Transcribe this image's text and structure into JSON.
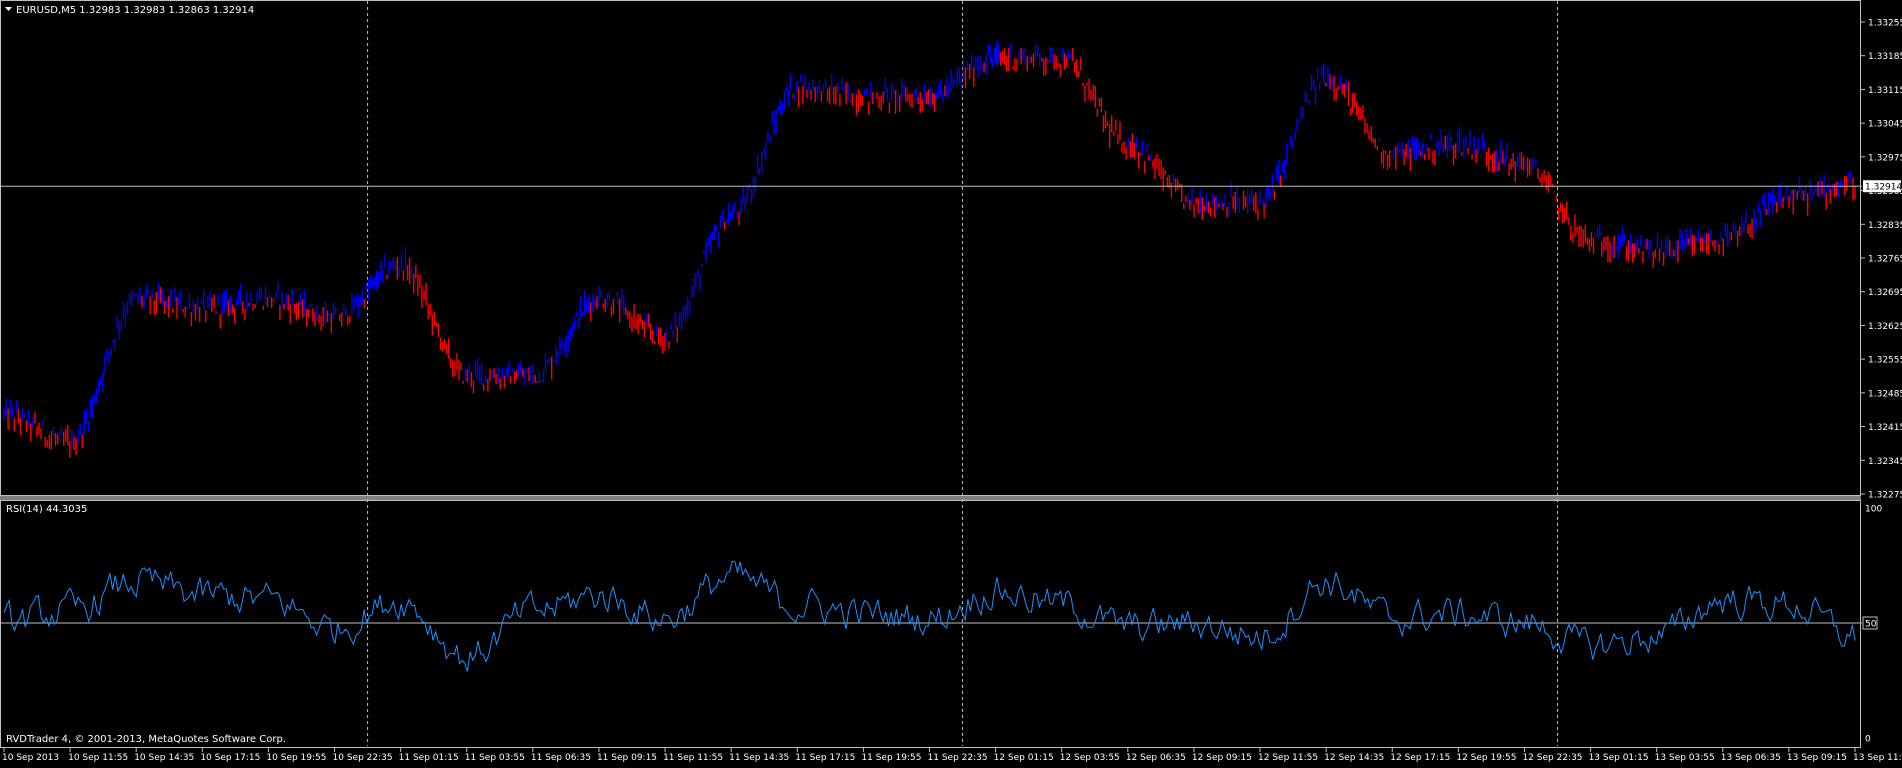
{
  "colors": {
    "background": "#000000",
    "frame": "#c0c0c0",
    "text": "#ffffff",
    "grid_dashed": "#c0c0c0",
    "bull": "#0000ff",
    "bear": "#ff0000",
    "rsi_line": "#1e90ff",
    "ref_line": "#c0c0c0"
  },
  "header": {
    "symbol_info": "EURUSD,M5  1.32983 1.32983 1.32863 1.32914",
    "dropdown_icon": "triangle-down-icon"
  },
  "price_panel": {
    "y_ticks": [
      "1.33255",
      "1.33185",
      "1.33115",
      "1.33045",
      "1.32975",
      "1.32905",
      "1.32835",
      "1.32765",
      "1.32695",
      "1.32625",
      "1.32555",
      "1.32485",
      "1.32415",
      "1.32345",
      "1.32275"
    ],
    "current_price": "1.32914"
  },
  "rsi_panel": {
    "label": "RSI(14) 44.3035",
    "y_ticks": [
      "100",
      "50",
      "0"
    ]
  },
  "x_ticks": [
    "10 Sep 2013",
    "10 Sep 11:55",
    "10 Sep 14:35",
    "10 Sep 17:15",
    "10 Sep 19:55",
    "10 Sep 22:35",
    "11 Sep 01:15",
    "11 Sep 03:55",
    "11 Sep 06:35",
    "11 Sep 09:15",
    "11 Sep 11:55",
    "11 Sep 14:35",
    "11 Sep 17:15",
    "11 Sep 19:55",
    "11 Sep 22:35",
    "12 Sep 01:15",
    "12 Sep 03:55",
    "12 Sep 06:35",
    "12 Sep 09:15",
    "12 Sep 11:55",
    "12 Sep 14:35",
    "12 Sep 17:15",
    "12 Sep 19:55",
    "12 Sep 22:35",
    "13 Sep 01:15",
    "13 Sep 03:55",
    "13 Sep 06:35",
    "13 Sep 09:15",
    "13 Sep 11:55"
  ],
  "footer": {
    "copyright": "RVDTrader 4, © 2001-2013, MetaQuotes Software Corp."
  },
  "chart_data": [
    {
      "type": "line",
      "title": "EURUSD,M5",
      "ylim": [
        1.32275,
        1.33255
      ],
      "series": [
        {
          "name": "EURUSD",
          "x": [
            "10 Sep 2013",
            "10 Sep 11:55",
            "10 Sep 14:35",
            "10 Sep 17:15",
            "10 Sep 19:55",
            "10 Sep 22:35",
            "11 Sep 01:15",
            "11 Sep 03:55",
            "11 Sep 06:35",
            "11 Sep 09:15",
            "11 Sep 11:55",
            "11 Sep 14:35",
            "11 Sep 17:15",
            "11 Sep 19:55",
            "11 Sep 22:35",
            "12 Sep 01:15",
            "12 Sep 03:55",
            "12 Sep 06:35",
            "12 Sep 09:15",
            "12 Sep 11:55",
            "12 Sep 14:35",
            "12 Sep 17:15",
            "12 Sep 19:55",
            "12 Sep 22:35",
            "13 Sep 01:15",
            "13 Sep 03:55",
            "13 Sep 06:35",
            "13 Sep 09:15",
            "13 Sep 11:55"
          ],
          "values": [
            1.3244,
            1.3238,
            1.3268,
            1.3266,
            1.3268,
            1.3264,
            1.3275,
            1.3252,
            1.3252,
            1.3268,
            1.326,
            1.3285,
            1.3312,
            1.331,
            1.331,
            1.3318,
            1.3318,
            1.33,
            1.3288,
            1.3288,
            1.3314,
            1.3298,
            1.33,
            1.3296,
            1.328,
            1.3278,
            1.328,
            1.3289,
            1.3292
          ]
        }
      ],
      "hline": 1.32914
    },
    {
      "type": "line",
      "title": "RSI(14) 44.3035",
      "ylim": [
        0,
        100
      ],
      "series": [
        {
          "name": "RSI(14)",
          "x": [
            "10 Sep 2013",
            "10 Sep 11:55",
            "10 Sep 14:35",
            "10 Sep 17:15",
            "10 Sep 19:55",
            "10 Sep 22:35",
            "11 Sep 01:15",
            "11 Sep 03:55",
            "11 Sep 06:35",
            "11 Sep 09:15",
            "11 Sep 11:55",
            "11 Sep 14:35",
            "11 Sep 17:15",
            "11 Sep 19:55",
            "11 Sep 22:35",
            "12 Sep 01:15",
            "12 Sep 03:55",
            "12 Sep 06:35",
            "12 Sep 09:15",
            "12 Sep 11:55",
            "12 Sep 14:35",
            "12 Sep 17:15",
            "12 Sep 19:55",
            "12 Sep 22:35",
            "13 Sep 01:15",
            "13 Sep 03:55",
            "13 Sep 06:35",
            "13 Sep 09:15",
            "13 Sep 11:55"
          ],
          "values": [
            50,
            55,
            68,
            62,
            60,
            48,
            60,
            35,
            55,
            62,
            52,
            70,
            58,
            54,
            52,
            64,
            58,
            48,
            50,
            44,
            68,
            52,
            54,
            50,
            40,
            44,
            60,
            58,
            44
          ]
        }
      ],
      "hline": 50
    }
  ]
}
